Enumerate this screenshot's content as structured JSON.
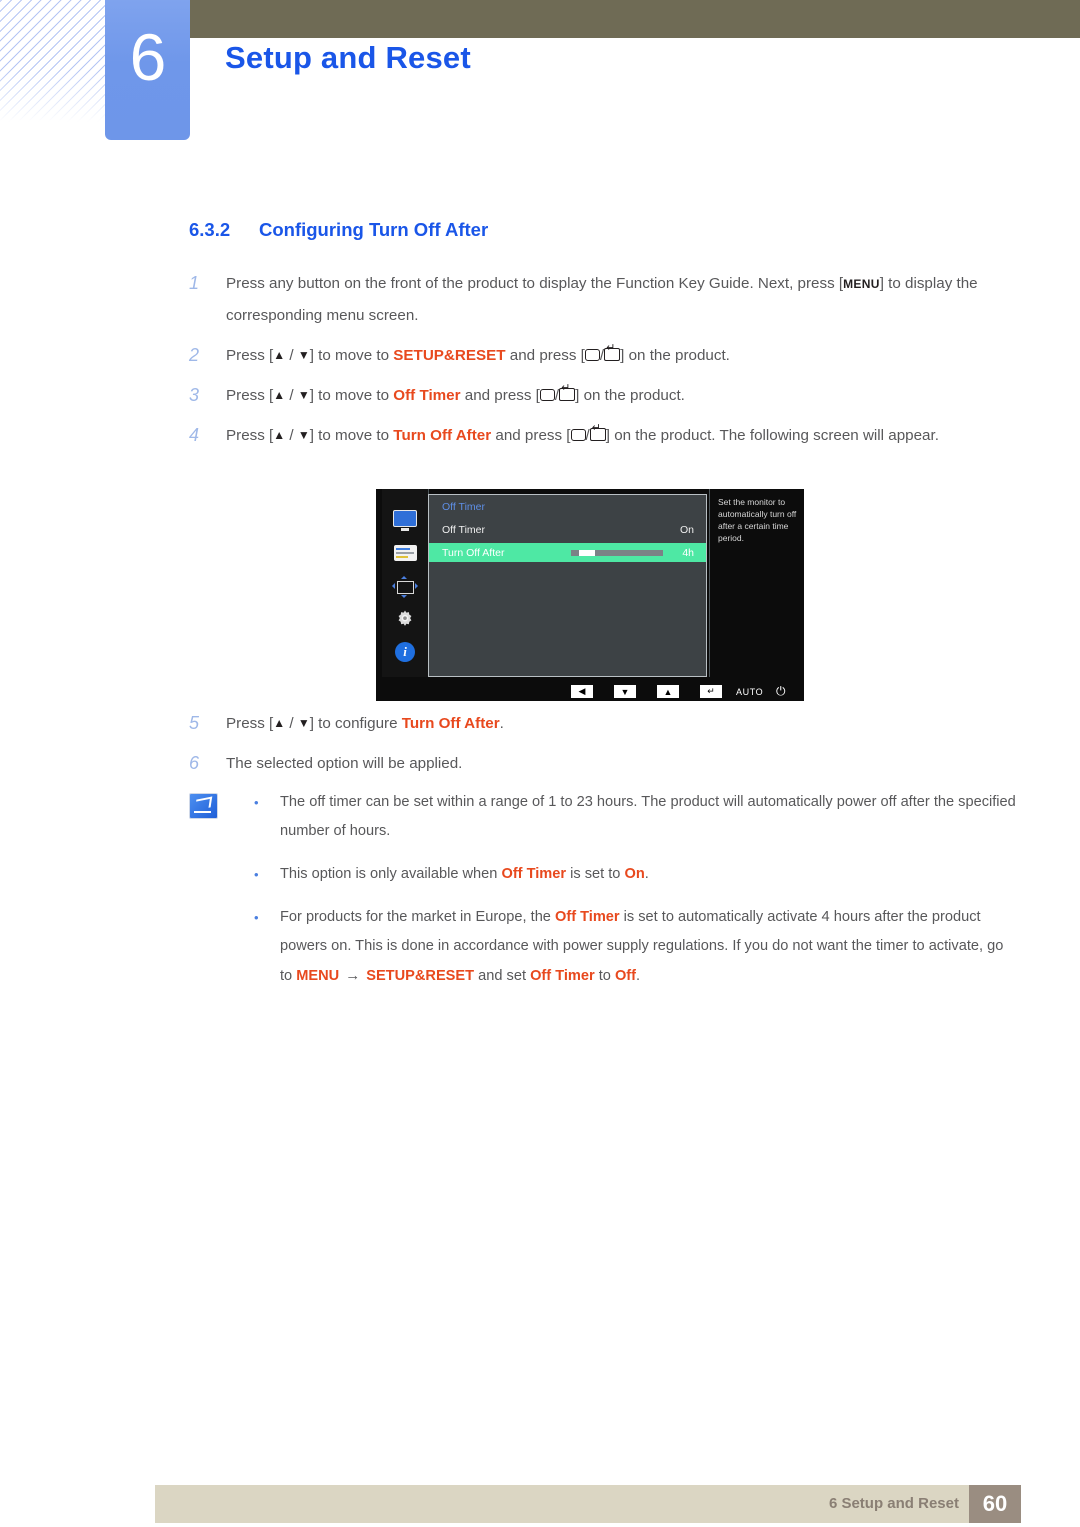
{
  "header": {
    "chapter_number": "6",
    "chapter_title": "Setup and Reset"
  },
  "section": {
    "number": "6.3.2",
    "title": "Configuring Turn Off After"
  },
  "steps": [
    {
      "num": "1",
      "parts": [
        {
          "t": "Press any button on the front of the product to display the Function Key Guide. Next, press ["
        },
        {
          "t": "MENU",
          "kind": "kbd"
        },
        {
          "t": "] to display the corresponding menu screen."
        }
      ]
    },
    {
      "num": "2",
      "parts": [
        {
          "t": "Press ["
        },
        {
          "t": "updown",
          "kind": "arrows"
        },
        {
          "t": "] to move to "
        },
        {
          "t": "SETUP&RESET",
          "kind": "em"
        },
        {
          "t": " and press ["
        },
        {
          "t": "rect-enter",
          "kind": "keys"
        },
        {
          "t": "] on the product."
        }
      ]
    },
    {
      "num": "3",
      "parts": [
        {
          "t": "Press ["
        },
        {
          "t": "updown",
          "kind": "arrows"
        },
        {
          "t": "] to move to "
        },
        {
          "t": "Off Timer",
          "kind": "em"
        },
        {
          "t": " and press ["
        },
        {
          "t": "rect-enter",
          "kind": "keys"
        },
        {
          "t": "] on the product."
        }
      ]
    },
    {
      "num": "4",
      "parts": [
        {
          "t": "Press ["
        },
        {
          "t": "updown",
          "kind": "arrows"
        },
        {
          "t": "] to move to "
        },
        {
          "t": "Turn Off After",
          "kind": "em"
        },
        {
          "t": " and press ["
        },
        {
          "t": "rect-enter",
          "kind": "keys"
        },
        {
          "t": "] on the product. The following screen will appear."
        }
      ]
    }
  ],
  "steps_after": [
    {
      "num": "5",
      "parts": [
        {
          "t": "Press ["
        },
        {
          "t": "updown",
          "kind": "arrows"
        },
        {
          "t": "] to configure "
        },
        {
          "t": "Turn Off After",
          "kind": "em"
        },
        {
          "t": "."
        }
      ]
    },
    {
      "num": "6",
      "parts": [
        {
          "t": "The selected option will be applied."
        }
      ]
    }
  ],
  "osd": {
    "sidebar_icons": [
      "monitor-icon",
      "osd-panel-icon",
      "position-arrows-icon",
      "gear-icon",
      "info-icon"
    ],
    "menu_title": "Off Timer",
    "rows": [
      {
        "label": "Off Timer",
        "value": "On",
        "highlighted": false,
        "slider": false
      },
      {
        "label": "Turn Off After",
        "value": "4h",
        "highlighted": true,
        "slider": true,
        "slider_percent": 17
      }
    ],
    "description": "Set the monitor to automatically turn off after a certain time period.",
    "bottom_buttons": [
      {
        "name": "left-button",
        "glyph": "◀"
      },
      {
        "name": "down-button",
        "glyph": "▼"
      },
      {
        "name": "up-button",
        "glyph": "▲"
      },
      {
        "name": "enter-button",
        "glyph": "↵"
      },
      {
        "name": "auto-button",
        "glyph": "AUTO"
      },
      {
        "name": "power-button",
        "glyph": "⏻"
      }
    ],
    "highlight_color": "#4ee8a4",
    "panel_color": "#3d4245",
    "title_color": "#5e8fe6"
  },
  "note": {
    "icon": "note-pencil-icon",
    "items": [
      {
        "parts": [
          {
            "t": "The off timer can be set within a range of 1 to 23 hours. The product will automatically power off after the specified number of hours."
          }
        ]
      },
      {
        "parts": [
          {
            "t": "This option is only available when "
          },
          {
            "t": "Off Timer",
            "kind": "em"
          },
          {
            "t": " is set to "
          },
          {
            "t": "On",
            "kind": "em"
          },
          {
            "t": "."
          }
        ]
      },
      {
        "parts": [
          {
            "t": "For products for the market in Europe, the "
          },
          {
            "t": "Off Timer",
            "kind": "em"
          },
          {
            "t": " is set to automatically activate 4 hours after the product powers on. This is done in accordance with power supply regulations. If you do not want the timer to activate, go to "
          },
          {
            "t": "MENU",
            "kind": "em"
          },
          {
            "t": "arrow",
            "kind": "arrow"
          },
          {
            "t": "SETUP&RESET",
            "kind": "em"
          },
          {
            "t": " and set "
          },
          {
            "t": "Off Timer",
            "kind": "em"
          },
          {
            "t": " to "
          },
          {
            "t": "Off",
            "kind": "em"
          },
          {
            "t": "."
          }
        ]
      }
    ]
  },
  "footer": {
    "text": "6 Setup and Reset",
    "page": "60"
  },
  "colors": {
    "heading_blue": "#1a56e8",
    "emphasis_orange": "#e8491e",
    "olive_bar": "#6f6b55",
    "tab_blue": "#6f97ea",
    "footer_beige": "#dbd6c3",
    "footer_page_box": "#9a8d81"
  }
}
